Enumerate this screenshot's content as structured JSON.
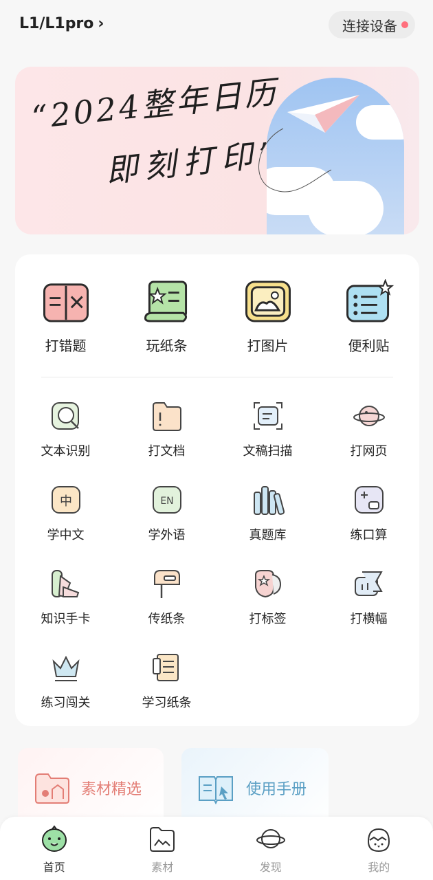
{
  "header": {
    "device_title": "L1/L1pro",
    "connect_label": "连接设备"
  },
  "banner": {
    "line1": "“2024整年日历",
    "line2": "即刻打印”"
  },
  "main_tools": [
    {
      "label": "打错题",
      "icon": "wrong-question-icon"
    },
    {
      "label": "玩纸条",
      "icon": "paper-scroll-icon"
    },
    {
      "label": "打图片",
      "icon": "picture-icon"
    },
    {
      "label": "便利贴",
      "icon": "sticky-note-icon"
    }
  ],
  "tools": [
    {
      "label": "文本识别",
      "icon": "text-recognition-icon"
    },
    {
      "label": "打文档",
      "icon": "document-folder-icon"
    },
    {
      "label": "文稿扫描",
      "icon": "scan-icon"
    },
    {
      "label": "打网页",
      "icon": "web-planet-icon"
    },
    {
      "label": "学中文",
      "icon": "chinese-character-icon"
    },
    {
      "label": "学外语",
      "icon": "english-en-icon"
    },
    {
      "label": "真题库",
      "icon": "books-icon"
    },
    {
      "label": "练口算",
      "icon": "calculator-icon"
    },
    {
      "label": "知识手卡",
      "icon": "cards-fan-icon"
    },
    {
      "label": "传纸条",
      "icon": "mailbox-icon"
    },
    {
      "label": "打标签",
      "icon": "label-tag-icon"
    },
    {
      "label": "打横幅",
      "icon": "banner-icon"
    },
    {
      "label": "练习闯关",
      "icon": "crown-icon"
    },
    {
      "label": "学习纸条",
      "icon": "study-note-icon"
    }
  ],
  "promos": [
    {
      "label": "素材精选",
      "icon": "material-folder-icon"
    },
    {
      "label": "使用手册",
      "icon": "manual-book-icon"
    }
  ],
  "tabbar": [
    {
      "label": "首页",
      "icon": "home-bird-icon",
      "active": true
    },
    {
      "label": "素材",
      "icon": "material-folder-icon"
    },
    {
      "label": "发现",
      "icon": "discover-planet-icon"
    },
    {
      "label": "我的",
      "icon": "profile-chick-icon"
    }
  ],
  "colors": {
    "accent_pink": "#ff6f7d",
    "promo_pink": "#e37d75",
    "promo_blue": "#5a9fc4"
  }
}
